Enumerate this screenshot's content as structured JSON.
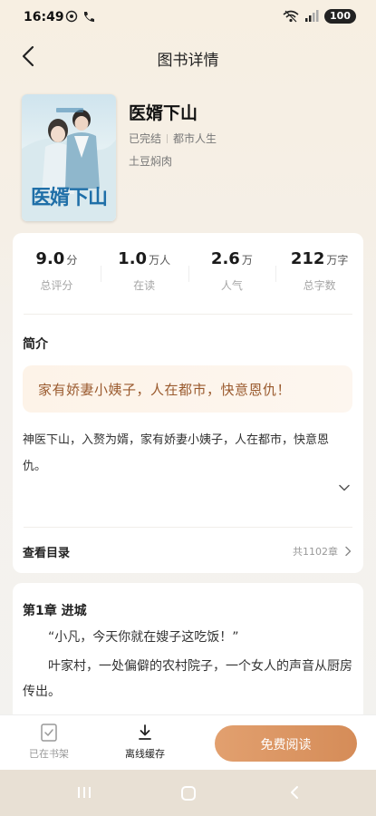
{
  "status": {
    "time": "16:49",
    "battery": "100"
  },
  "header": {
    "title": "图书详情"
  },
  "book": {
    "title": "医婿下山",
    "cover_text": "医婿下山",
    "status": "已完结",
    "category": "都市人生",
    "author": "土豆焖肉"
  },
  "stats": [
    {
      "value": "9.0",
      "unit": "分",
      "label": "总评分"
    },
    {
      "value": "1.0",
      "unit": "万人",
      "label": "在读"
    },
    {
      "value": "2.6",
      "unit": "万",
      "label": "人气"
    },
    {
      "value": "212",
      "unit": "万字",
      "label": "总字数"
    }
  ],
  "intro": {
    "heading": "简介",
    "quote": "家有娇妻小姨子，人在都市，快意恩仇！",
    "body": "神医下山，入赘为婿，家有娇妻小姨子，人在都市，快意恩仇。"
  },
  "toc": {
    "label": "查看目录",
    "count": "共1102章"
  },
  "chapter": {
    "title": "第1章  进城",
    "paragraphs": [
      "“小凡，今天你就在嫂子这吃饭！”",
      "叶家村，一处偏僻的农村院子，一个女人的声音从厨房传出。"
    ]
  },
  "bottom_bar": {
    "on_shelf": "已在书架",
    "offline_cache": "离线缓存",
    "read_button": "免费阅读"
  },
  "colors": {
    "accent": "#d9915e",
    "quote_text": "#9a5a2e",
    "cover_title": "#1f6fa8"
  }
}
